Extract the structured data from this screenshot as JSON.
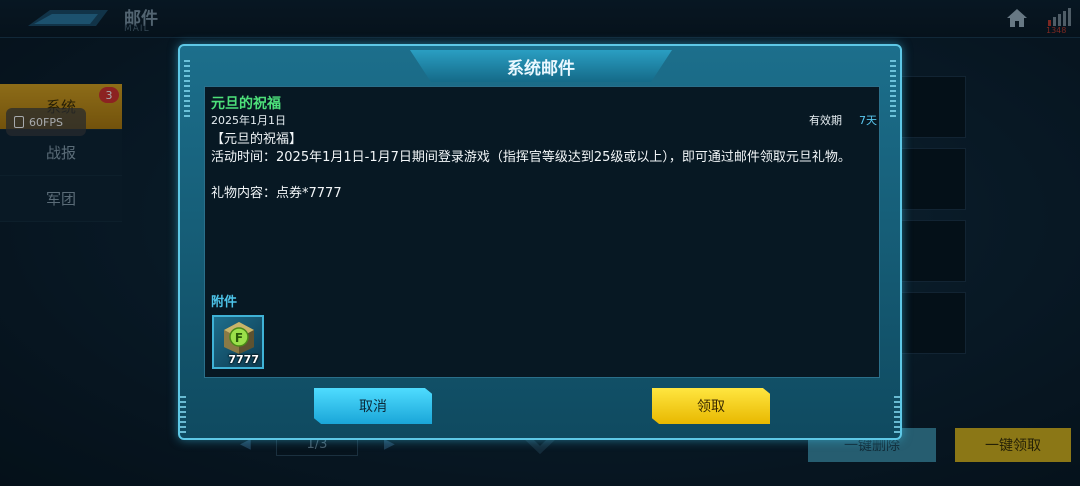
{
  "header": {
    "title": "邮件",
    "subtitle": "MAIL",
    "signal_value": "1348"
  },
  "sidebar": {
    "tabs": [
      {
        "label": "系统",
        "active": true,
        "badge": "3"
      },
      {
        "label": "战报",
        "active": false
      },
      {
        "label": "军团",
        "active": false
      }
    ]
  },
  "overlay": {
    "fps": "60FPS"
  },
  "list_footer": {
    "page": "1/3",
    "delete_all": "一键删除",
    "claim_all": "一键领取"
  },
  "modal": {
    "title": "系统邮件",
    "mail": {
      "title": "元旦的祝福",
      "date": "2025年1月1日",
      "validity_label": "有效期",
      "validity_value": "7天",
      "heading": "【元旦的祝福】",
      "body": "活动时间：2025年1月1日-1月7日期间登录游戏（指挥官等级达到25级或以上），即可通过邮件领取元旦礼物。",
      "gift": "礼物内容：点券*7777"
    },
    "attachment_label": "附件",
    "attachments": [
      {
        "icon": "voucher-cube-icon",
        "quantity": "7777"
      }
    ],
    "buttons": {
      "cancel": "取消",
      "claim": "领取"
    }
  },
  "colors": {
    "accent_cyan": "#5ec8e6",
    "title_green": "#4de07a",
    "claim_yellow": "#ffe640",
    "badge_red": "#d8302a"
  }
}
